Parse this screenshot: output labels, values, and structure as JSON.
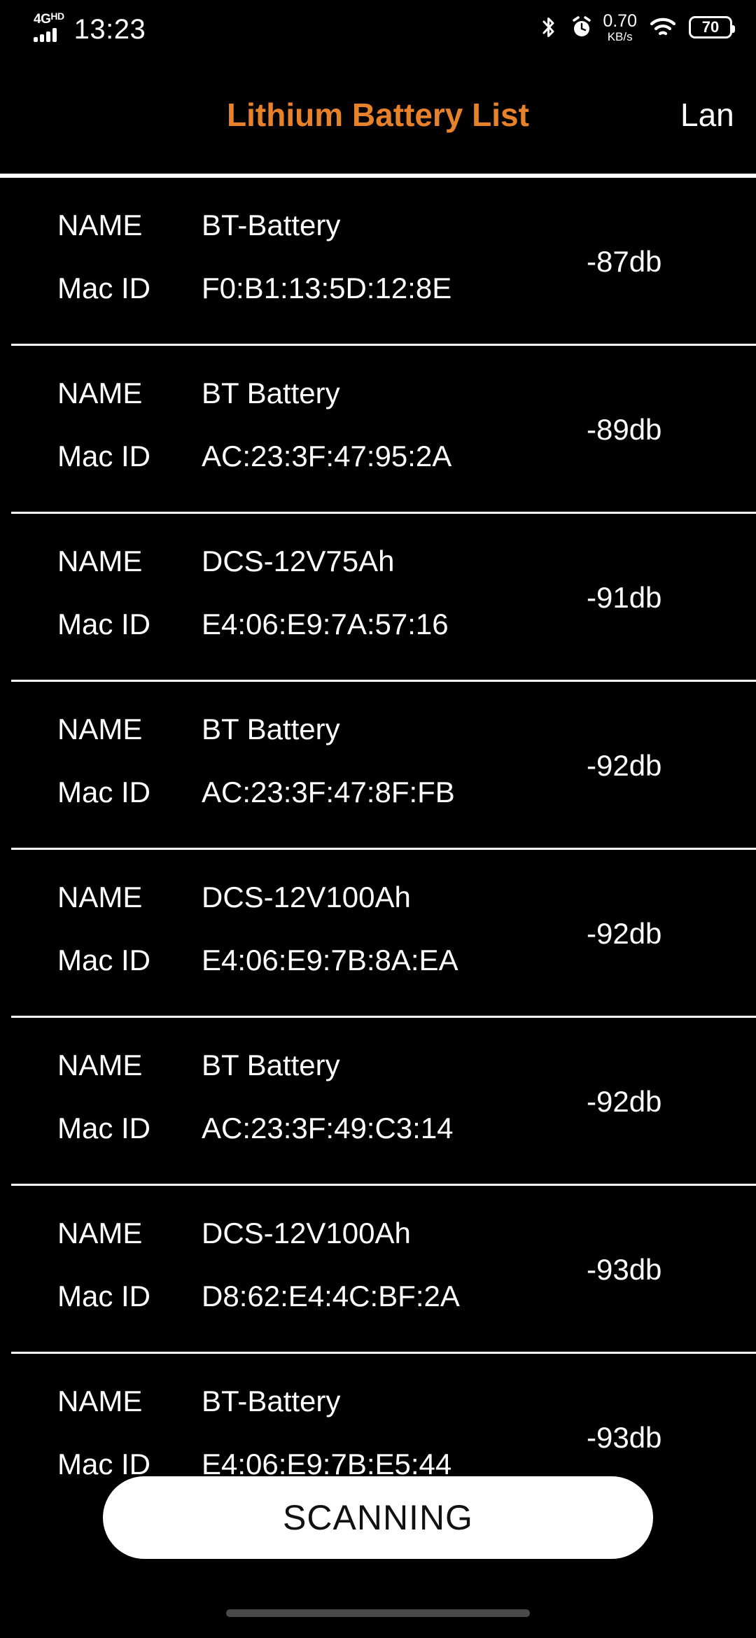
{
  "status_bar": {
    "network_label": "4G",
    "network_sup": "HD",
    "signal_icon": "signal-bars-icon",
    "time": "13:23",
    "bluetooth_icon": "bluetooth-icon",
    "alarm_icon": "alarm-clock-icon",
    "net_speed_value": "0.70",
    "net_speed_unit": "KB/s",
    "wifi_icon": "wifi-icon",
    "battery_level": "70"
  },
  "header": {
    "title": "Lithium Battery List",
    "action_label": "Lan",
    "title_color": "#E8822A"
  },
  "list": {
    "name_key": "NAME",
    "mac_key": "Mac ID",
    "devices": [
      {
        "name": "BT-Battery",
        "mac": "F0:B1:13:5D:12:8E",
        "rssi": "-87db"
      },
      {
        "name": "BT Battery",
        "mac": "AC:23:3F:47:95:2A",
        "rssi": "-89db"
      },
      {
        "name": "DCS-12V75Ah",
        "mac": "E4:06:E9:7A:57:16",
        "rssi": "-91db"
      },
      {
        "name": "BT Battery",
        "mac": "AC:23:3F:47:8F:FB",
        "rssi": "-92db"
      },
      {
        "name": "DCS-12V100Ah",
        "mac": "E4:06:E9:7B:8A:EA",
        "rssi": "-92db"
      },
      {
        "name": "BT Battery",
        "mac": "AC:23:3F:49:C3:14",
        "rssi": "-92db"
      },
      {
        "name": "DCS-12V100Ah",
        "mac": "D8:62:E4:4C:BF:2A",
        "rssi": "-93db"
      },
      {
        "name": "BT-Battery",
        "mac": "E4:06:E9:7B:E5:44",
        "rssi": "-93db"
      }
    ]
  },
  "scan": {
    "button_label": "SCANNING"
  },
  "nav": {
    "home_indicator": "home-indicator"
  }
}
